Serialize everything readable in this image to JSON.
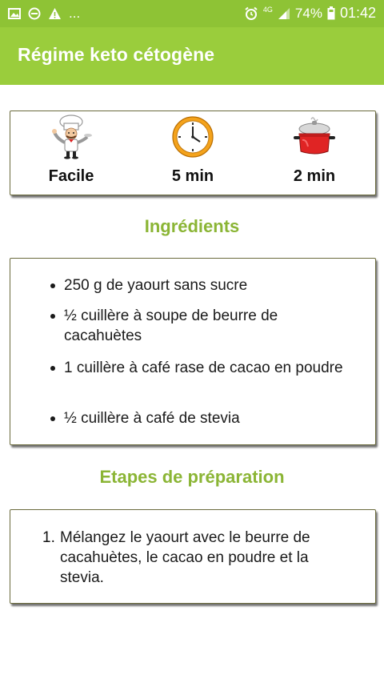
{
  "status_bar": {
    "left_icons": [
      "image-icon",
      "minus-circle-icon",
      "warning-icon"
    ],
    "ellipsis": "...",
    "network": "4G",
    "battery": "74%",
    "time": "01:42"
  },
  "app_bar": {
    "title": "Régime keto cétogène"
  },
  "info": {
    "difficulty": "Facile",
    "prep_time": "5 min",
    "cook_time": "2 min"
  },
  "ingredients": {
    "title": "Ingrédients",
    "items": [
      "250 g de yaourt sans sucre",
      "½ cuillère à soupe de beurre de cacahuètes",
      "1 cuillère à café rase de cacao en poudre",
      "½ cuillère à café de stevia"
    ]
  },
  "steps": {
    "title": "Etapes de préparation",
    "items": [
      "Mélangez le yaourt avec le beurre de cacahuètes, le cacao en poudre et la stevia."
    ]
  },
  "colors": {
    "app_bar": "#9acd3c",
    "status_bar": "#8ec335",
    "section_title": "#8bb535"
  }
}
